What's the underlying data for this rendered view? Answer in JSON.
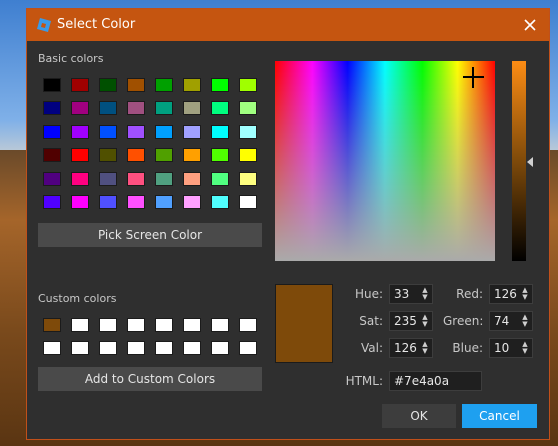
{
  "dialog": {
    "title": "Select Color"
  },
  "basic": {
    "label": "Basic colors",
    "colors": [
      "#000000",
      "#a00000",
      "#005000",
      "#a05000",
      "#00a000",
      "#a0a000",
      "#00ff00",
      "#a0ff00",
      "#000080",
      "#a00080",
      "#005080",
      "#a05080",
      "#00a080",
      "#a0a080",
      "#00ff80",
      "#a0ff80",
      "#0000ff",
      "#a000ff",
      "#0050ff",
      "#a050ff",
      "#00a0ff",
      "#a0a0ff",
      "#00ffff",
      "#a0ffff",
      "#500000",
      "#ff0000",
      "#505000",
      "#ff5000",
      "#50a000",
      "#ffa000",
      "#50ff00",
      "#ffff00",
      "#500080",
      "#ff0080",
      "#505080",
      "#ff5080",
      "#50a080",
      "#ffa080",
      "#50ff80",
      "#ffff80",
      "#5000ff",
      "#ff00ff",
      "#5050ff",
      "#ff50ff",
      "#50a0ff",
      "#ffa0ff",
      "#50ffff",
      "#ffffff"
    ],
    "pick_label": "Pick Screen Color"
  },
  "custom": {
    "label": "Custom colors",
    "colors": [
      "#7e4a0a",
      "#ffffff",
      "#ffffff",
      "#ffffff",
      "#ffffff",
      "#ffffff",
      "#ffffff",
      "#ffffff",
      "#ffffff",
      "#ffffff",
      "#ffffff",
      "#ffffff",
      "#ffffff",
      "#ffffff",
      "#ffffff",
      "#ffffff"
    ],
    "add_label": "Add to Custom Colors"
  },
  "fields": {
    "hue_label": "Hue:",
    "hue": "33",
    "sat_label": "Sat:",
    "sat": "235",
    "val_label": "Val:",
    "val": "126",
    "red_label": "Red:",
    "red": "126",
    "green_label": "Green:",
    "green": "74",
    "blue_label": "Blue:",
    "blue": "10",
    "html_label": "HTML:",
    "html": "#7e4a0a"
  },
  "current_color": "#7e4a0a",
  "buttons": {
    "ok": "OK",
    "cancel": "Cancel"
  },
  "colors": {
    "titlebar": "#c55510",
    "accent": "#1ea0f0"
  }
}
